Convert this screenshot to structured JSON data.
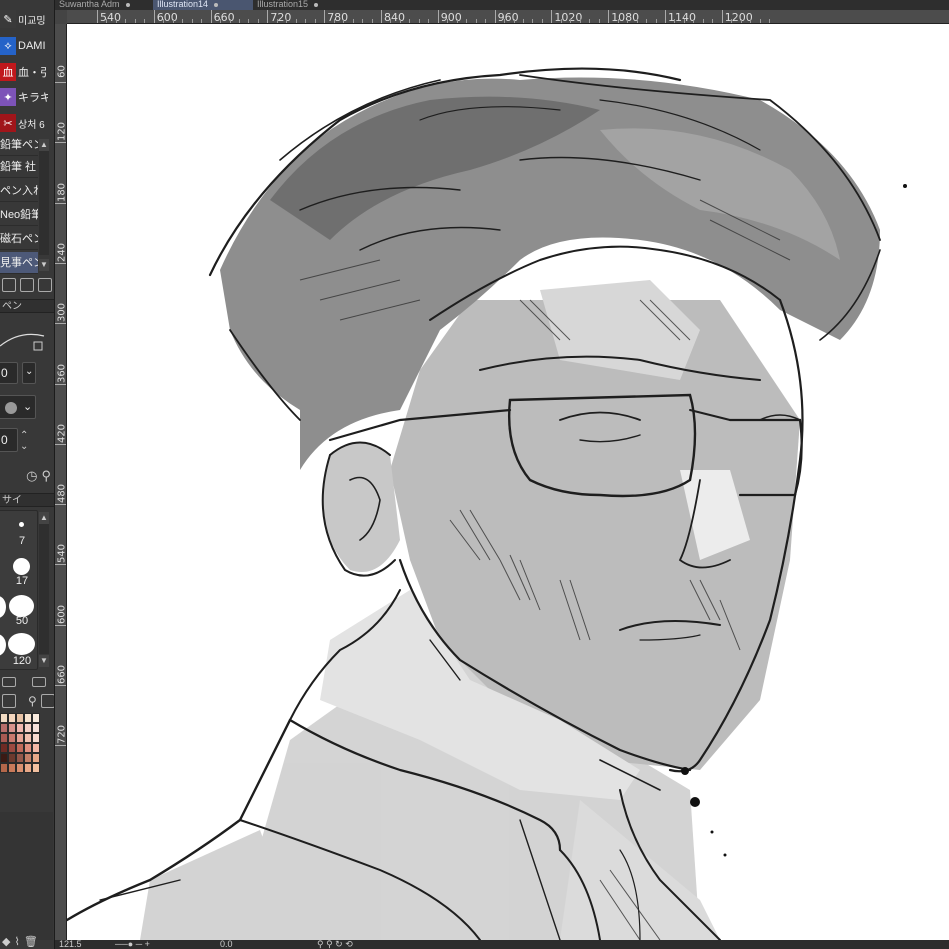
{
  "tabs": [
    {
      "label": "Suwantha Adm",
      "active": false
    },
    {
      "label": "Illustration14",
      "active": true
    },
    {
      "label": "Illustration15",
      "active": false
    }
  ],
  "ruler_top": [
    "540",
    "600",
    "660",
    "720",
    "780",
    "840",
    "900",
    "960",
    "1020",
    "1080",
    "1140",
    "1200"
  ],
  "ruler_left": [
    "60",
    "120",
    "180",
    "240",
    "300",
    "360",
    "420",
    "480",
    "540",
    "600",
    "660",
    "720"
  ],
  "sub_tools": [
    {
      "icon": "pen-nib-icon",
      "label": "미교밍",
      "color": "#3a3a3a"
    },
    {
      "icon": "dami-icon",
      "label": "DAMI",
      "color": "#2563c8"
    },
    {
      "icon": "blood-icon",
      "label": "血・引",
      "color": "#c0181c"
    },
    {
      "icon": "sparkle-icon",
      "label": "キラキ",
      "color": "#7d53b8"
    },
    {
      "icon": "wound-icon",
      "label": "상처 6",
      "color": "#a0151a"
    }
  ],
  "brushes": [
    {
      "label": "鉛筆ペン"
    },
    {
      "label": "鉛筆 社"
    },
    {
      "label": "ペン入れ"
    },
    {
      "label": "Neo鉛筆"
    },
    {
      "label": "磁石ペン"
    },
    {
      "label": "見事ペン",
      "selected": true
    }
  ],
  "tool_property_tab": "ペン",
  "brush_size_value": "0",
  "opacity_value": "0",
  "brush_size_tab": "サイ",
  "brush_sizes": [
    "7",
    "17",
    "50",
    "120"
  ],
  "palette_colors": [
    "#f3dcc4",
    "#f5d6bd",
    "#e8c2a4",
    "#f7e3cf",
    "#f9ebde",
    "#b86e6a",
    "#d8938c",
    "#f1b7ae",
    "#f4cfc6",
    "#f6e1da",
    "#a85a52",
    "#c97a6e",
    "#e6a394",
    "#f0c0b0",
    "#f8dbd0",
    "#6e2b24",
    "#9b4a40",
    "#c06a5a",
    "#e09080",
    "#f4b8a6",
    "#3b1a14",
    "#6c3a2e",
    "#94584a",
    "#c48068",
    "#e8a888",
    "#b4674a",
    "#c97a5a",
    "#d99070",
    "#e8a888",
    "#f2c0a0"
  ],
  "status": {
    "zoom": "121.5",
    "angle": "0.0"
  },
  "colors": {
    "active_tab": "#4a5670",
    "selected_brush": "#4d5978",
    "panel_bg": "#383838",
    "ruler_bg": "#4c4c4c",
    "canvas_bg": "#ffffff"
  }
}
